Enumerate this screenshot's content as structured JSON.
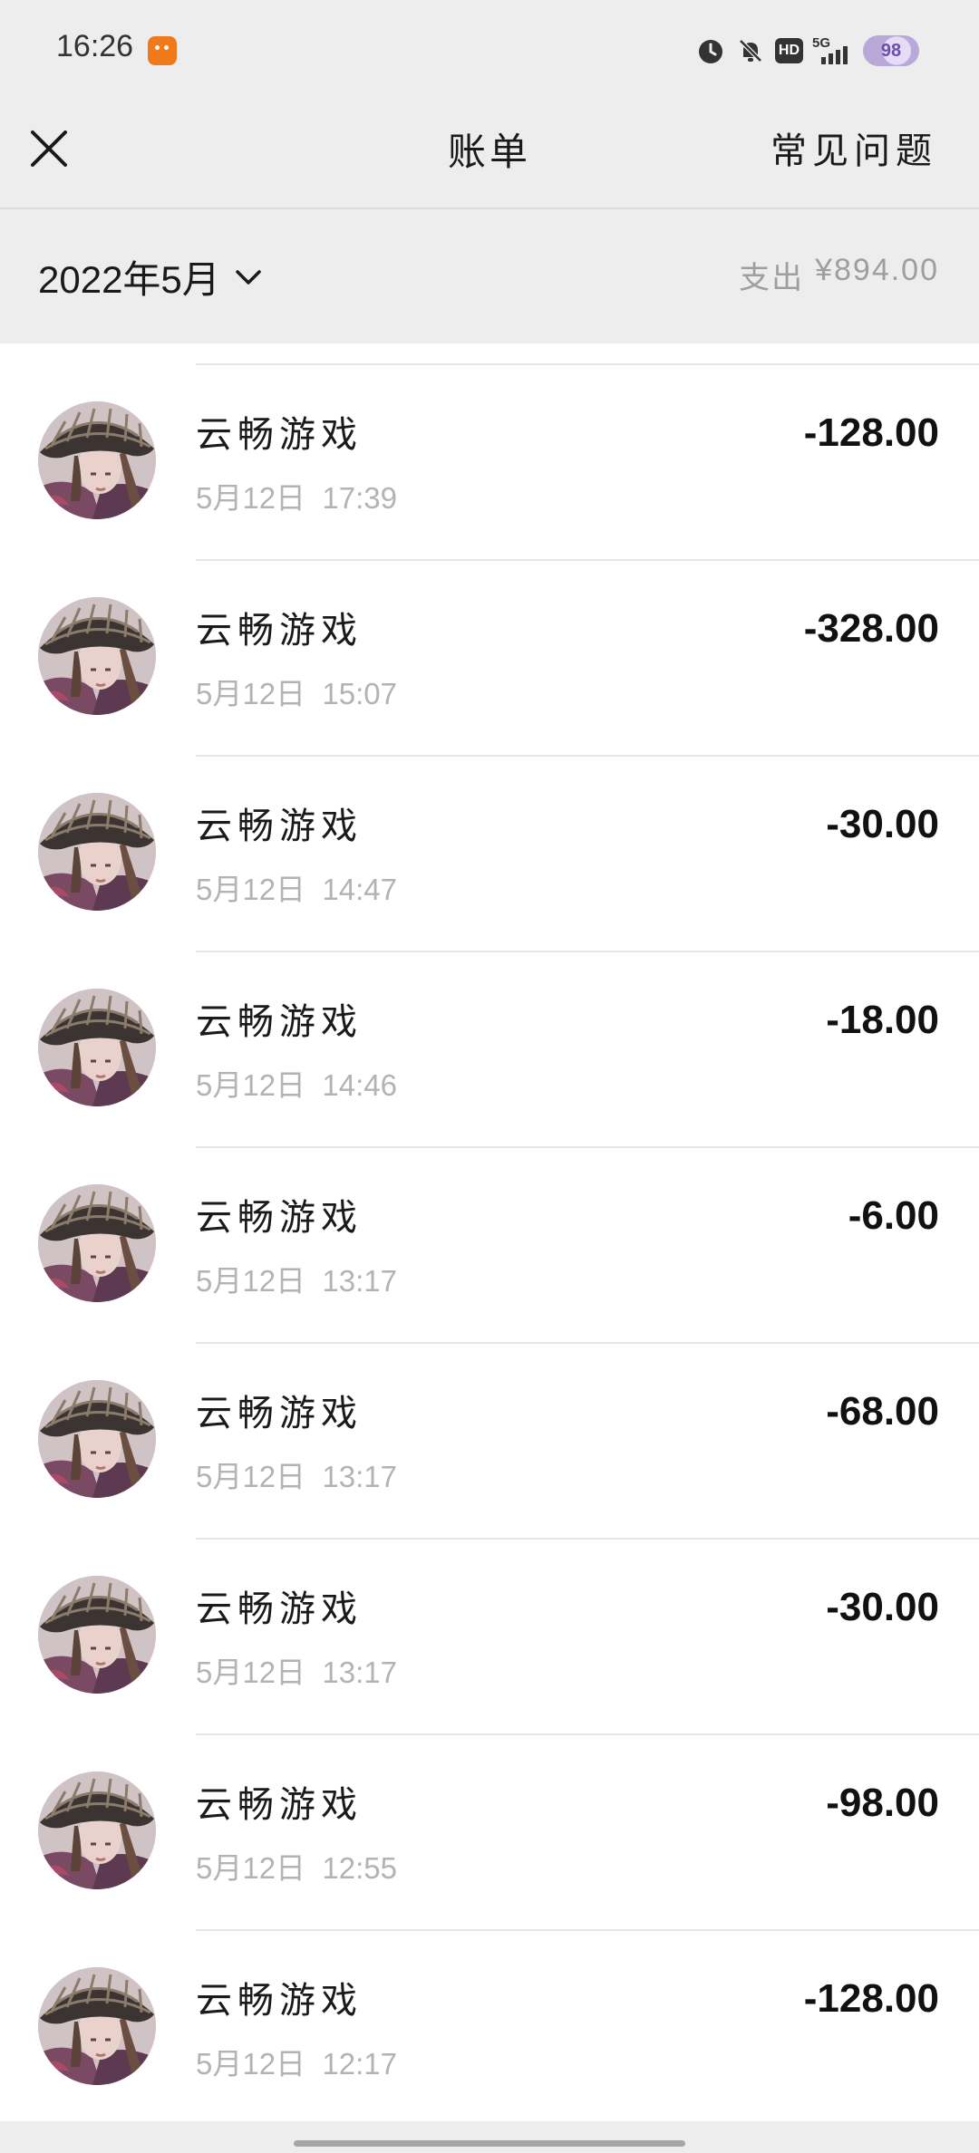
{
  "status_bar": {
    "time": "16:26",
    "signal": "5G",
    "hd": "HD",
    "battery": "98",
    "icons": [
      "alarm-icon",
      "mute-icon",
      "hd-icon",
      "signal-5g-icon",
      "battery-icon"
    ]
  },
  "nav": {
    "title": "账单",
    "faq": "常见问题",
    "close_icon": "close-icon"
  },
  "month": {
    "label": "2022年5月",
    "expense_label": "支出",
    "expense_amount": "¥894.00"
  },
  "transactions": [
    {
      "title": "云畅游戏",
      "date": "5月12日",
      "time": "17:39",
      "amount": "-128.00"
    },
    {
      "title": "云畅游戏",
      "date": "5月12日",
      "time": "15:07",
      "amount": "-328.00"
    },
    {
      "title": "云畅游戏",
      "date": "5月12日",
      "time": "14:47",
      "amount": "-30.00"
    },
    {
      "title": "云畅游戏",
      "date": "5月12日",
      "time": "14:46",
      "amount": "-18.00"
    },
    {
      "title": "云畅游戏",
      "date": "5月12日",
      "time": "13:17",
      "amount": "-6.00"
    },
    {
      "title": "云畅游戏",
      "date": "5月12日",
      "time": "13:17",
      "amount": "-68.00"
    },
    {
      "title": "云畅游戏",
      "date": "5月12日",
      "time": "13:17",
      "amount": "-30.00"
    },
    {
      "title": "云畅游戏",
      "date": "5月12日",
      "time": "12:55",
      "amount": "-98.00"
    },
    {
      "title": "云畅游戏",
      "date": "5月12日",
      "time": "12:17",
      "amount": "-128.00"
    }
  ],
  "colors": {
    "background": "#ededed",
    "list_background": "#ffffff",
    "secondary_text": "#b3b3b3",
    "primary_text": "#1a1a1a"
  }
}
